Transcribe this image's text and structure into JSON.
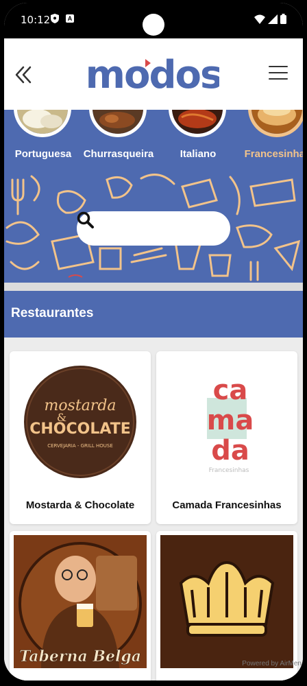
{
  "status": {
    "time": "10:12",
    "badge": "A"
  },
  "header": {
    "logo_text": "modos"
  },
  "search": {
    "placeholder": ""
  },
  "categories": [
    {
      "label": "Portuguesa",
      "active": false
    },
    {
      "label": "Churrasqueira",
      "active": false
    },
    {
      "label": "Italiano",
      "active": false
    },
    {
      "label": "Francesinhas",
      "active": true
    }
  ],
  "section": {
    "title": "Restaurantes"
  },
  "restaurants": [
    {
      "name": "Mostarda & Chocolate",
      "logo_line1": "mostarda",
      "logo_amp": "&",
      "logo_line2": "CHOCOLATE",
      "logo_sub": "CERVEJARIA - GRILL HOUSE"
    },
    {
      "name": "Camada Francesinhas",
      "logo_rows": [
        "ca",
        "ma",
        "da"
      ],
      "logo_sub": "Francesinhas"
    },
    {
      "name": "",
      "logo_text": "Taberna Belga"
    },
    {
      "name": ""
    }
  ],
  "footer": {
    "powered": "Powered by AirMen"
  },
  "colors": {
    "brand_blue": "#4e6ab0",
    "accent_orange": "#f2c38a",
    "logo_red": "#d94a4a",
    "logo_brown": "#4a2a1a"
  }
}
